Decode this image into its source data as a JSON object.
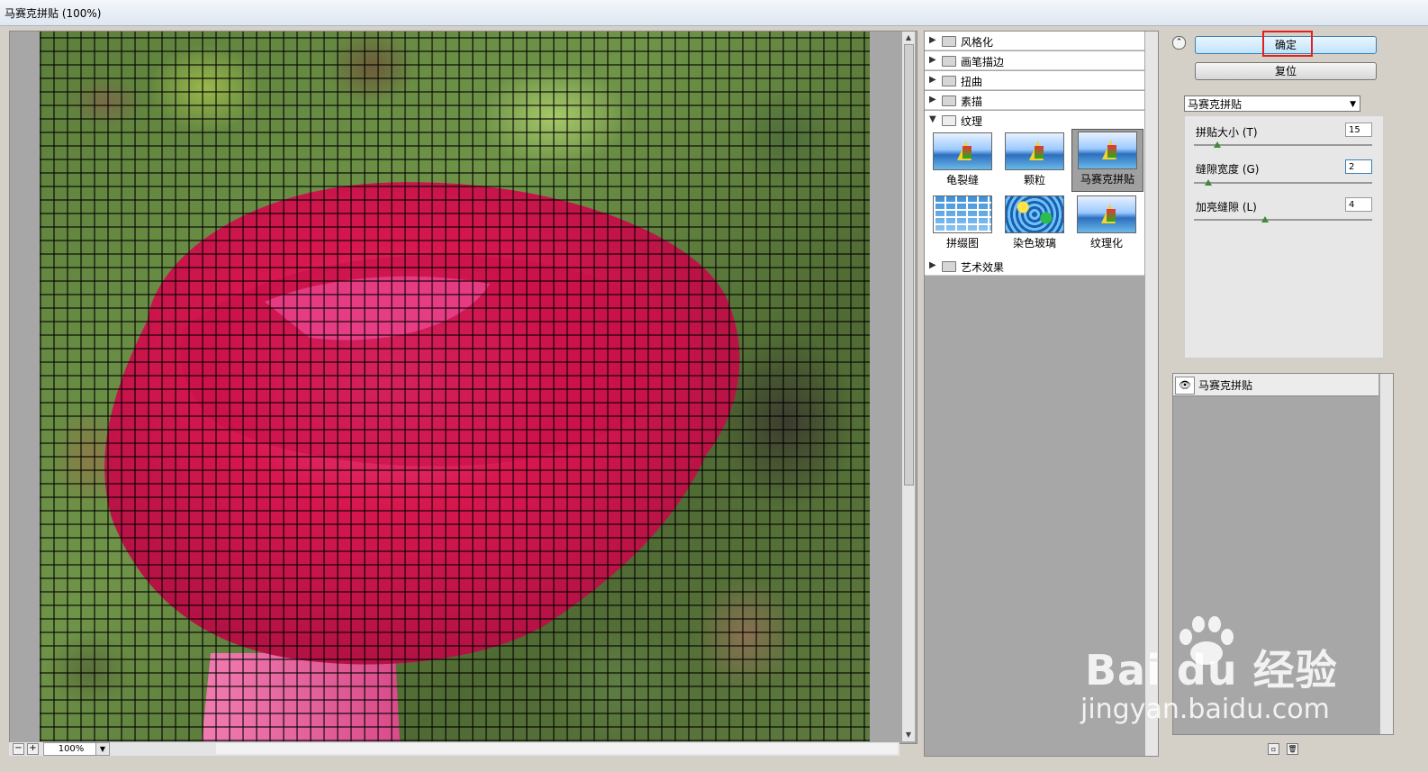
{
  "window": {
    "title": "马赛克拼贴 (100%)"
  },
  "preview": {
    "zoom_value": "100%",
    "zoom_out": "−",
    "zoom_in": "+"
  },
  "gallery": {
    "categories_top": [
      {
        "label": "风格化",
        "expanded": false
      },
      {
        "label": "画笔描边",
        "expanded": false
      },
      {
        "label": "扭曲",
        "expanded": false
      },
      {
        "label": "素描",
        "expanded": false
      },
      {
        "label": "纹理",
        "expanded": true
      }
    ],
    "texture_filters": [
      {
        "label": "龟裂缝",
        "selected": false,
        "thumb": "boat"
      },
      {
        "label": "颗粒",
        "selected": false,
        "thumb": "boat"
      },
      {
        "label": "马赛克拼贴",
        "selected": true,
        "thumb": "boat"
      },
      {
        "label": "拼缀图",
        "selected": false,
        "thumb": "tile"
      },
      {
        "label": "染色玻璃",
        "selected": false,
        "thumb": "glass"
      },
      {
        "label": "纹理化",
        "selected": false,
        "thumb": "boat"
      }
    ],
    "category_bottom": {
      "label": "艺术效果",
      "expanded": false
    }
  },
  "controls": {
    "ok_label": "确定",
    "reset_label": "复位",
    "filter_select": "马赛克拼贴",
    "params": [
      {
        "label": "拼贴大小 (T)",
        "value": "15",
        "fraction": 0.13
      },
      {
        "label": "缝隙宽度 (G)",
        "value": "2",
        "fraction": 0.08
      },
      {
        "label": "加亮缝隙 (L)",
        "value": "4",
        "fraction": 0.4
      }
    ]
  },
  "layers": [
    {
      "name": "马赛克拼贴",
      "visible": true
    }
  ],
  "watermark": {
    "brand": "Bai du 经验",
    "url": "jingyan.baidu.com"
  },
  "colors": {
    "ok_highlight": "#e02020",
    "slider_knob": "#3d8a3a"
  }
}
